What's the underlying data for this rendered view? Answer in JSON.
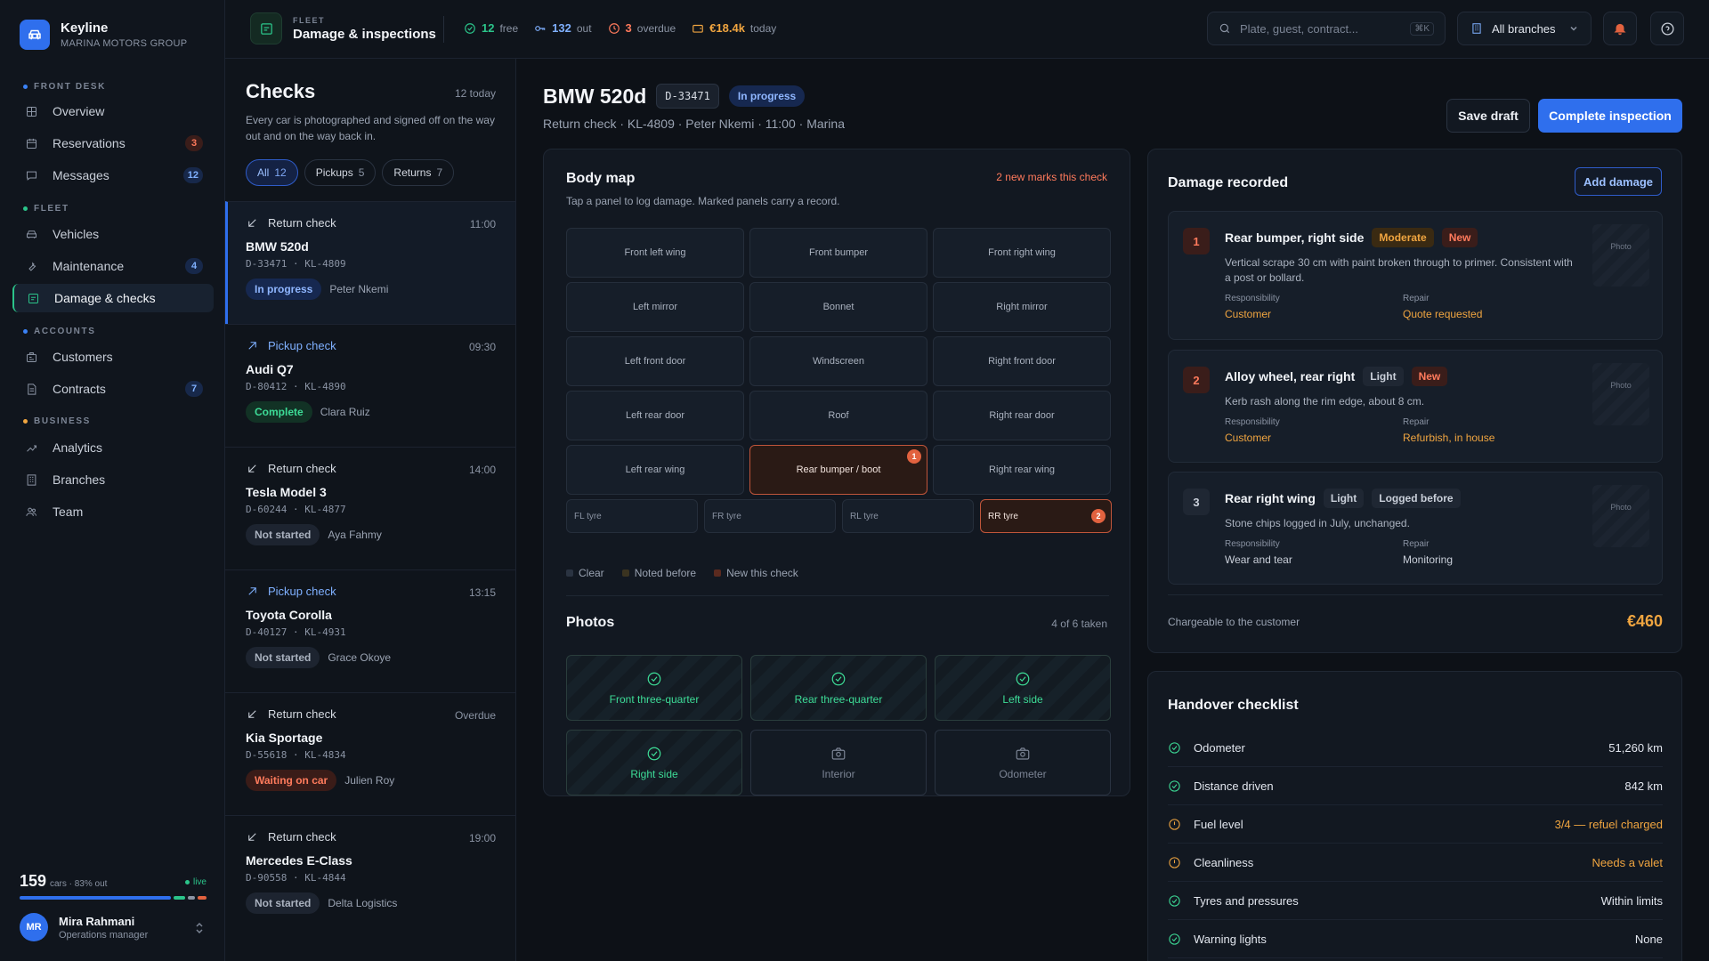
{
  "app": {
    "name": "Keyline",
    "org": "MARINA MOTORS GROUP"
  },
  "nav": {
    "sections": [
      {
        "label": "FRONT DESK",
        "color": "#3b82f6"
      },
      {
        "label": "FLEET",
        "color": "#2bc48a"
      },
      {
        "label": "ACCOUNTS",
        "color": "#3b82f6"
      },
      {
        "label": "BUSINESS",
        "color": "#f0a540"
      }
    ],
    "items": [
      {
        "label": "Overview",
        "icon": "grid-icon",
        "badge": ""
      },
      {
        "label": "Reservations",
        "icon": "calendar-icon",
        "badge": "3"
      },
      {
        "label": "Messages",
        "icon": "chat-icon",
        "badge": "12"
      },
      {
        "label": "Vehicles",
        "icon": "car-icon",
        "badge": ""
      },
      {
        "label": "Maintenance",
        "icon": "wrench-icon",
        "badge": "4"
      },
      {
        "label": "Damage & checks",
        "icon": "clipboard-icon",
        "badge": ""
      },
      {
        "label": "Customers",
        "icon": "id-card-icon",
        "badge": ""
      },
      {
        "label": "Contracts",
        "icon": "document-icon",
        "badge": "7"
      },
      {
        "label": "Analytics",
        "icon": "trend-icon",
        "badge": ""
      },
      {
        "label": "Branches",
        "icon": "building-icon",
        "badge": ""
      },
      {
        "label": "Team",
        "icon": "people-icon",
        "badge": ""
      }
    ]
  },
  "fleet_summary": {
    "count": "159",
    "meta": "cars · 83% out",
    "live": "live",
    "out_fraction": 0.83
  },
  "user": {
    "initials": "MR",
    "name": "Mira Rahmani",
    "role": "Operations manager"
  },
  "topbar": {
    "kicker": "FLEET",
    "title": "Damage & inspections",
    "stats": [
      {
        "value": "12",
        "label": "free",
        "color": "#2bc48a",
        "icon": "check-circle-icon"
      },
      {
        "value": "132",
        "label": "out",
        "color": "#7fb0ff",
        "icon": "key-icon"
      },
      {
        "value": "3",
        "label": "overdue",
        "color": "#ff7a5c",
        "icon": "clock-icon"
      },
      {
        "value": "€18.4k",
        "label": "today",
        "color": "#f0a540",
        "icon": "wallet-icon"
      }
    ],
    "search_placeholder": "Plate, guest, contract...",
    "search_shortcut": "⌘K",
    "branch": "All branches"
  },
  "checks": {
    "title": "Checks",
    "today": "12 today",
    "description": "Every car is photographed and signed off on the way out and on the way back in.",
    "filters": [
      {
        "label": "All",
        "count": "12"
      },
      {
        "label": "Pickups",
        "count": "5"
      },
      {
        "label": "Returns",
        "count": "7"
      }
    ],
    "items": [
      {
        "type": "Return check",
        "kind": "return",
        "time": "11:00",
        "car": "BMW 520d",
        "ids": "D-33471 · KL-4809",
        "status": "In progress",
        "status_kind": "progress",
        "person": "Peter Nkemi"
      },
      {
        "type": "Pickup check",
        "kind": "pickup",
        "time": "09:30",
        "car": "Audi Q7",
        "ids": "D-80412 · KL-4890",
        "status": "Complete",
        "status_kind": "complete",
        "person": "Clara Ruiz"
      },
      {
        "type": "Return check",
        "kind": "return",
        "time": "14:00",
        "car": "Tesla Model 3",
        "ids": "D-60244 · KL-4877",
        "status": "Not started",
        "status_kind": "not",
        "person": "Aya Fahmy"
      },
      {
        "type": "Pickup check",
        "kind": "pickup",
        "time": "13:15",
        "car": "Toyota Corolla",
        "ids": "D-40127 · KL-4931",
        "status": "Not started",
        "status_kind": "not",
        "person": "Grace Okoye"
      },
      {
        "type": "Return check",
        "kind": "return",
        "time": "Overdue",
        "car": "Kia Sportage",
        "ids": "D-55618 · KL-4834",
        "status": "Waiting on car",
        "status_kind": "wait",
        "person": "Julien Roy"
      },
      {
        "type": "Return check",
        "kind": "return",
        "time": "19:00",
        "car": "Mercedes E-Class",
        "ids": "D-90558 · KL-4844",
        "status": "Not started",
        "status_kind": "not",
        "person": "Delta Logistics"
      }
    ]
  },
  "inspection": {
    "car": "BMW 520d",
    "id": "D-33471",
    "status": "In progress",
    "subtitle": "Return check · KL-4809 · Peter Nkemi · 11:00 · Marina",
    "save_label": "Save draft",
    "complete_label": "Complete inspection"
  },
  "body_map": {
    "title": "Body map",
    "new_marks": "2 new marks this check",
    "hint": "Tap a panel to log damage. Marked panels carry a record.",
    "panels": [
      {
        "label": "Front left wing",
        "mark": ""
      },
      {
        "label": "Front bumper",
        "mark": ""
      },
      {
        "label": "Front right wing",
        "mark": ""
      },
      {
        "label": "Left mirror",
        "mark": ""
      },
      {
        "label": "Bonnet",
        "mark": ""
      },
      {
        "label": "Right mirror",
        "mark": ""
      },
      {
        "label": "Left front door",
        "mark": ""
      },
      {
        "label": "Windscreen",
        "mark": ""
      },
      {
        "label": "Right front door",
        "mark": ""
      },
      {
        "label": "Left rear door",
        "mark": ""
      },
      {
        "label": "Roof",
        "mark": ""
      },
      {
        "label": "Right rear door",
        "mark": ""
      },
      {
        "label": "Left rear wing",
        "mark": ""
      },
      {
        "label": "Rear bumper / boot",
        "mark": "1"
      },
      {
        "label": "Right rear wing",
        "mark": ""
      }
    ],
    "tyres": [
      {
        "label": "FL tyre",
        "mark": ""
      },
      {
        "label": "FR tyre",
        "mark": ""
      },
      {
        "label": "RL tyre",
        "mark": ""
      },
      {
        "label": "RR tyre",
        "mark": "2"
      }
    ],
    "legend": [
      {
        "label": "Clear",
        "color": "#2a3341"
      },
      {
        "label": "Noted before",
        "color": "#3a3320"
      },
      {
        "label": "New this check",
        "color": "#5a2a1f"
      }
    ]
  },
  "photos": {
    "title": "Photos",
    "count": "4 of 6 taken",
    "items": [
      {
        "label": "Front three-quarter",
        "taken": true
      },
      {
        "label": "Rear three-quarter",
        "taken": true
      },
      {
        "label": "Left side",
        "taken": true
      },
      {
        "label": "Right side",
        "taken": true
      },
      {
        "label": "Interior",
        "taken": false
      },
      {
        "label": "Odometer",
        "taken": false
      }
    ]
  },
  "damage": {
    "title": "Damage recorded",
    "add_label": "Add damage",
    "photo_label": "Photo",
    "responsibility_label": "Responsibility",
    "repair_label": "Repair",
    "items": [
      {
        "num": "1",
        "title": "Rear bumper, right side",
        "tags": [
          "Moderate",
          "New"
        ],
        "desc": "Vertical scrape 30 cm with paint broken through to primer. Consistent with a post or bollard.",
        "responsibility": "Customer",
        "repair": "Quote requested",
        "highlight": true
      },
      {
        "num": "2",
        "title": "Alloy wheel, rear right",
        "tags": [
          "Light",
          "New"
        ],
        "desc": "Kerb rash along the rim edge, about 8 cm.",
        "responsibility": "Customer",
        "repair": "Refurbish, in house",
        "highlight": true
      },
      {
        "num": "3",
        "title": "Rear right wing",
        "tags": [
          "Light",
          "Logged before"
        ],
        "desc": "Stone chips logged in July, unchanged.",
        "responsibility": "Wear and tear",
        "repair": "Monitoring",
        "highlight": false
      }
    ],
    "charge_label": "Chargeable to the customer",
    "charge_value": "€460"
  },
  "handover": {
    "title": "Handover checklist",
    "items": [
      {
        "label": "Odometer",
        "value": "51,260 km",
        "ok": true
      },
      {
        "label": "Distance driven",
        "value": "842 km",
        "ok": true
      },
      {
        "label": "Fuel level",
        "value": "3/4 — refuel charged",
        "ok": false
      },
      {
        "label": "Cleanliness",
        "value": "Needs a valet",
        "ok": false
      },
      {
        "label": "Tyres and pressures",
        "value": "Within limits",
        "ok": true
      },
      {
        "label": "Warning lights",
        "value": "None",
        "ok": true
      }
    ]
  }
}
